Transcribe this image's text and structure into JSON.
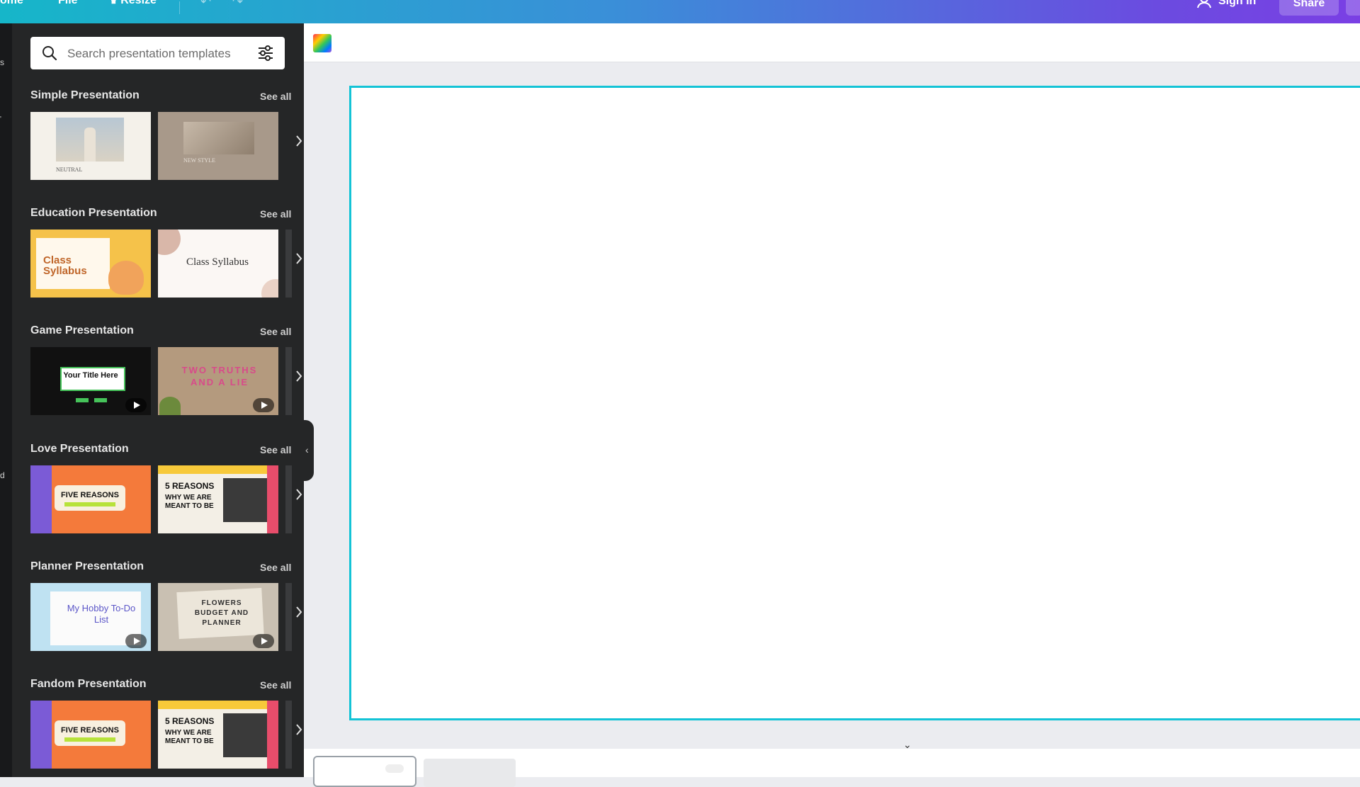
{
  "topbar": {
    "home_label": "ome",
    "file_label": "File",
    "resize_label": "Resize",
    "signin_label": "Sign in",
    "share_label": "Share"
  },
  "siderail": {
    "items": [
      "s",
      "d"
    ]
  },
  "search": {
    "placeholder": "Search presentation templates"
  },
  "sections": [
    {
      "title": "Simple Presentation",
      "see_all": "See all"
    },
    {
      "title": "Education Presentation",
      "see_all": "See all"
    },
    {
      "title": "Game Presentation",
      "see_all": "See all"
    },
    {
      "title": "Love Presentation",
      "see_all": "See all"
    },
    {
      "title": "Planner Presentation",
      "see_all": "See all"
    },
    {
      "title": "Fandom Presentation",
      "see_all": "See all"
    }
  ],
  "templates": {
    "simple_1": "NEUTRAL",
    "simple_2": "NEW STYLE",
    "edu_1": "Class Syllabus",
    "edu_2": "Class Syllabus",
    "game_1": "Your Title Here",
    "game_2": "TWO TRUTHS AND A LIE",
    "love_1": "FIVE REASONS",
    "love_2_a": "5 REASONS",
    "love_2_b": "WHY WE ARE MEANT TO BE",
    "planner_1": "My Hobby To-Do List",
    "planner_2": "FLOWERS BUDGET AND PLANNER",
    "fandom_1": "FIVE REASONS",
    "fandom_2_a": "5 REASONS",
    "fandom_2_b": "WHY WE ARE MEANT TO BE"
  },
  "colors": {
    "accent": "#13c3d6",
    "panel": "#252627",
    "canvas_border": "#13c3d6"
  }
}
